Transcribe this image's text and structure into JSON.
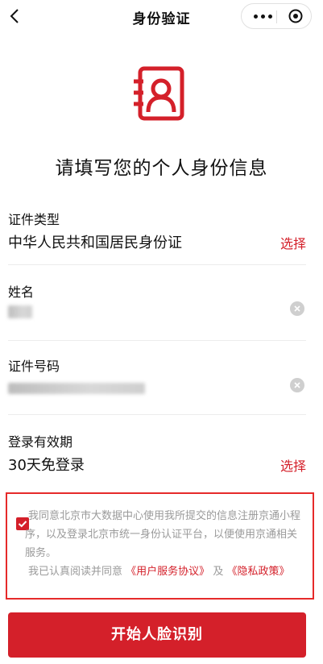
{
  "nav": {
    "title": "身份验证"
  },
  "heading": "请填写您的个人身份信息",
  "fields": [
    {
      "label": "证件类型",
      "value": "中华人民共和国居民身份证",
      "action": "选择"
    },
    {
      "label": "姓名"
    },
    {
      "label": "证件号码"
    },
    {
      "label": "登录有效期",
      "value": "30天免登录",
      "action": "选择"
    }
  ],
  "agreement": {
    "line1": "我同意北京市大数据中心使用我所提交的信息注册京通小程序，以及登录北京市统一身份认证平台，以便使用京通相关服务。",
    "line2_prefix": "我已认真阅读并同意",
    "user_agreement": "《用户服务协议》",
    "and": "及",
    "privacy_policy": "《隐私政策》",
    "checked": true
  },
  "start_button": "开始人脸识别",
  "colors": {
    "accent": "#d4202a",
    "highlight_border": "#e62a2a"
  }
}
